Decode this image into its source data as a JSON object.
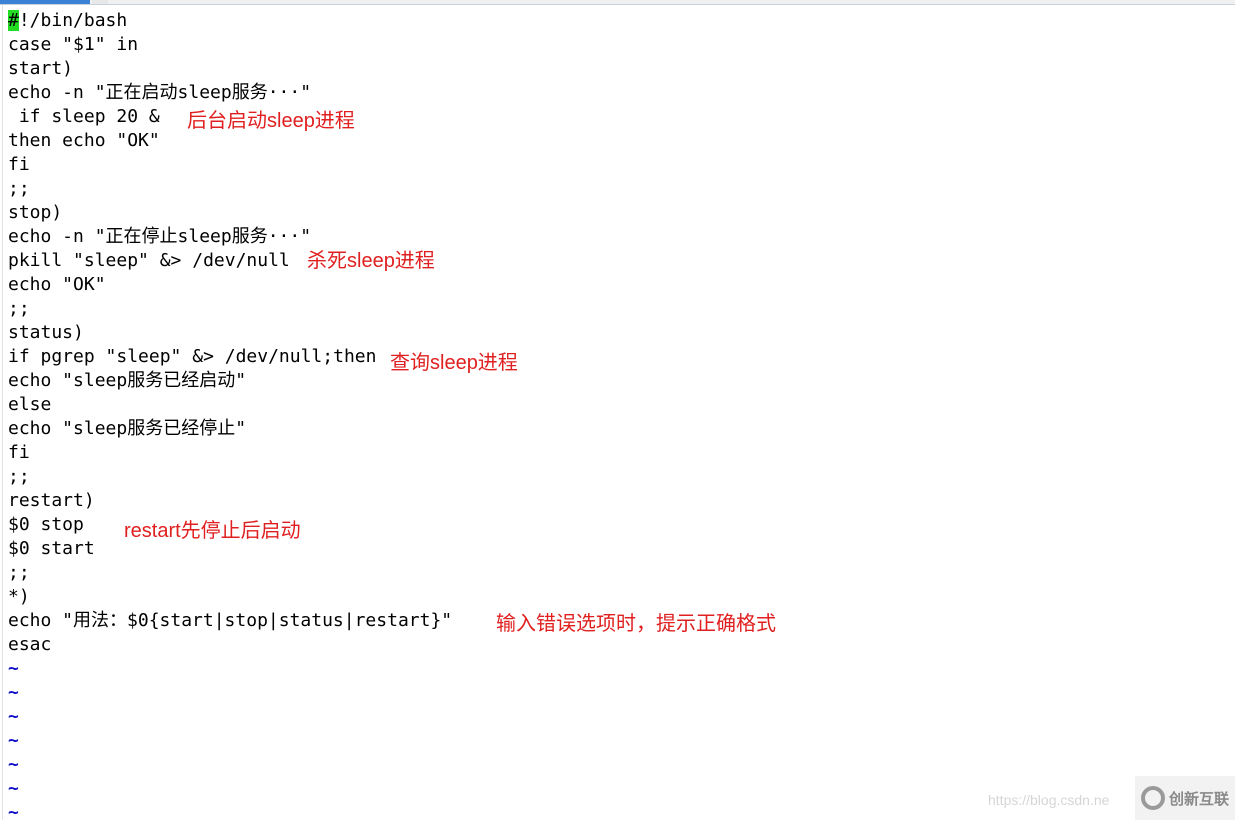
{
  "editor": {
    "lines": [
      "#!/bin/bash",
      "case \"$1\" in",
      "start)",
      "echo -n \"正在启动sleep服务···\"",
      " if sleep 20 &",
      "then echo \"OK\"",
      "fi",
      ";;",
      "stop)",
      "echo -n \"正在停止sleep服务···\"",
      "pkill \"sleep\" &> /dev/null",
      "echo \"OK\"",
      ";;",
      "status)",
      "if pgrep \"sleep\" &> /dev/null;then",
      "echo \"sleep服务已经启动\"",
      "else",
      "echo \"sleep服务已经停止\"",
      "fi",
      ";;",
      "restart)",
      "$0 stop",
      "$0 start",
      ";;",
      "*)",
      "echo \"用法：$0{start|stop|status|restart}\"",
      "esac"
    ],
    "empty_line_marker": "~",
    "empty_line_count": 7,
    "tilde_color": "#1414c8",
    "cursor_color": "#22dd22"
  },
  "annotations": [
    "后台启动sleep进程",
    "杀死sleep进程",
    "查询sleep进程",
    "restart先停止后启动",
    "输入错误选项时，提示正确格式"
  ],
  "annotation_color": "#e02020",
  "watermark": {
    "url": "https://blog.csdn.ne",
    "logo_text": "创新互联"
  }
}
